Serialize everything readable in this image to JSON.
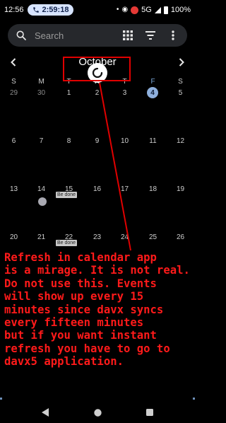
{
  "status_bar": {
    "time": "12:56",
    "call_timer": "2:59:18",
    "network": "5G",
    "battery": "100%"
  },
  "search": {
    "placeholder": "Search"
  },
  "calendar": {
    "month": "October",
    "weekdays": [
      "S",
      "M",
      "T",
      "W",
      "T",
      "F",
      "S"
    ],
    "weeks": [
      [
        "29",
        "30",
        "1",
        "2",
        "3",
        "4",
        "5"
      ],
      [
        "6",
        "7",
        "8",
        "9",
        "10",
        "11",
        "12"
      ],
      [
        "13",
        "14",
        "15",
        "16",
        "17",
        "18",
        "19"
      ],
      [
        "20",
        "21",
        "22",
        "23",
        "24",
        "25",
        "26"
      ]
    ],
    "today": "4",
    "events": [
      {
        "day": "14",
        "label": "Be done"
      },
      {
        "day": "22",
        "label": "Be done"
      }
    ]
  },
  "annotation": {
    "text": "Refresh in calendar app is a mirage. It is not real. Do not use this. Events will show up every 15 minutes since davx syncs every fifteen minutes but if you want instant refresh you have to go to davx5 application.",
    "lines": [
      "Refresh in calendar app",
      "is a mirage. It is not real.",
      "Do not use this. Events",
      "will show up every 15",
      "minutes since davx syncs",
      "every fifteen minutes",
      "but if you want instant",
      "refresh you have to go to",
      "davx5 application."
    ],
    "color": "#e00000"
  },
  "colors": {
    "background": "#000000",
    "search_bg": "#26282c",
    "today_accent": "#8fb0dd",
    "friday_header": "#7aa7d8"
  }
}
